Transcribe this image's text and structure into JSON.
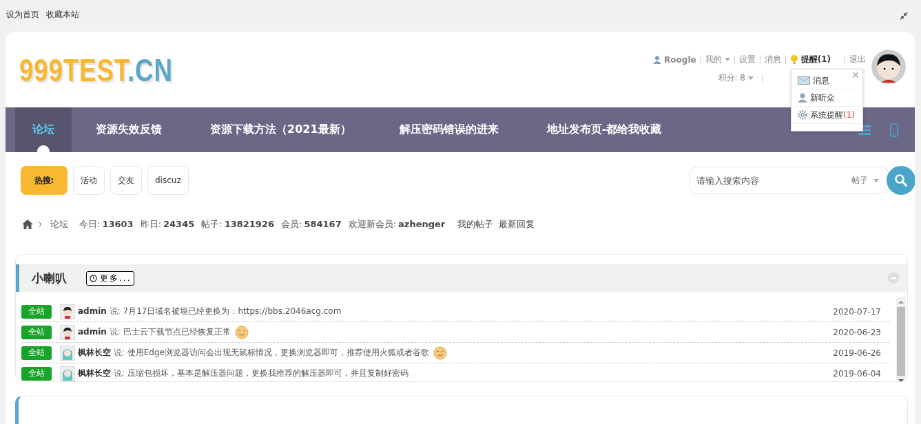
{
  "top_links": [
    "设为首页",
    "收藏本站"
  ],
  "logo": {
    "main": "999TEST",
    "suffix": ".CN"
  },
  "user_bar": {
    "username": "Roogle",
    "items": [
      {
        "label": "我的",
        "dropdown": true
      },
      {
        "label": "设置",
        "dropdown": false
      },
      {
        "label": "消息",
        "dropdown": false
      }
    ],
    "reminder": "提醒(1)",
    "logout": "退出",
    "points": "积分: 8"
  },
  "reminder_menu": [
    {
      "kind": "mail",
      "label": "消息"
    },
    {
      "kind": "user",
      "label": "新听众"
    },
    {
      "kind": "gear",
      "label": "系统提醒",
      "count": "(1)"
    }
  ],
  "nav": [
    {
      "label": "论坛",
      "selected": true
    },
    {
      "label": "资源失效反馈",
      "selected": false
    },
    {
      "label": "资源下载方法（2021最新）",
      "selected": false
    },
    {
      "label": "解压密码错误的进来",
      "selected": false
    },
    {
      "label": "地址发布页-都给我收藏",
      "selected": false
    }
  ],
  "hot_search": {
    "label": "热搜:",
    "tags": [
      "活动",
      "交友",
      "discuz"
    ]
  },
  "search": {
    "placeholder": "请输入搜索内容",
    "type": "帖子"
  },
  "breadcrumb": {
    "current": "论坛",
    "stats": [
      {
        "label": "今日:",
        "value": "13603"
      },
      {
        "label": "昨日:",
        "value": "24345"
      },
      {
        "label": "帖子:",
        "value": "13821926"
      },
      {
        "label": "会员:",
        "value": "584167"
      },
      {
        "label": "欢迎新会员:",
        "value": "azhenger"
      }
    ],
    "links": [
      "我的帖子",
      "最新回复"
    ]
  },
  "announcements": {
    "title": "小喇叭",
    "more": "更多...",
    "rows": [
      {
        "tag": "全站",
        "avatar": {
          "kind": "boy"
        },
        "author": "admin",
        "says": "说:",
        "text": "7月17日域名被墙已经更换为：https://bbs.2046acg.com",
        "emoji": false,
        "date": "2020-07-17"
      },
      {
        "tag": "全站",
        "avatar": {
          "kind": "boy"
        },
        "author": "admin",
        "says": "说:",
        "text": "巴士云下载节点已经恢复正常",
        "emoji": true,
        "date": "2020-06-23"
      },
      {
        "tag": "全站",
        "avatar": {
          "kind": "girl"
        },
        "author": "枫林长空",
        "says": "说:",
        "text": "使用Edge浏览器访问会出现无鼠标情况，更换浏览器即可，推荐使用火狐或者谷歌",
        "emoji": true,
        "date": "2019-06-26"
      },
      {
        "tag": "全站",
        "avatar": {
          "kind": "girl"
        },
        "author": "枫林长空",
        "says": "说:",
        "text": "压缩包损坏，基本是解压器问题，更换我推荐的解压器即可，并且复制好密码",
        "emoji": false,
        "date": "2019-06-04"
      }
    ]
  }
}
